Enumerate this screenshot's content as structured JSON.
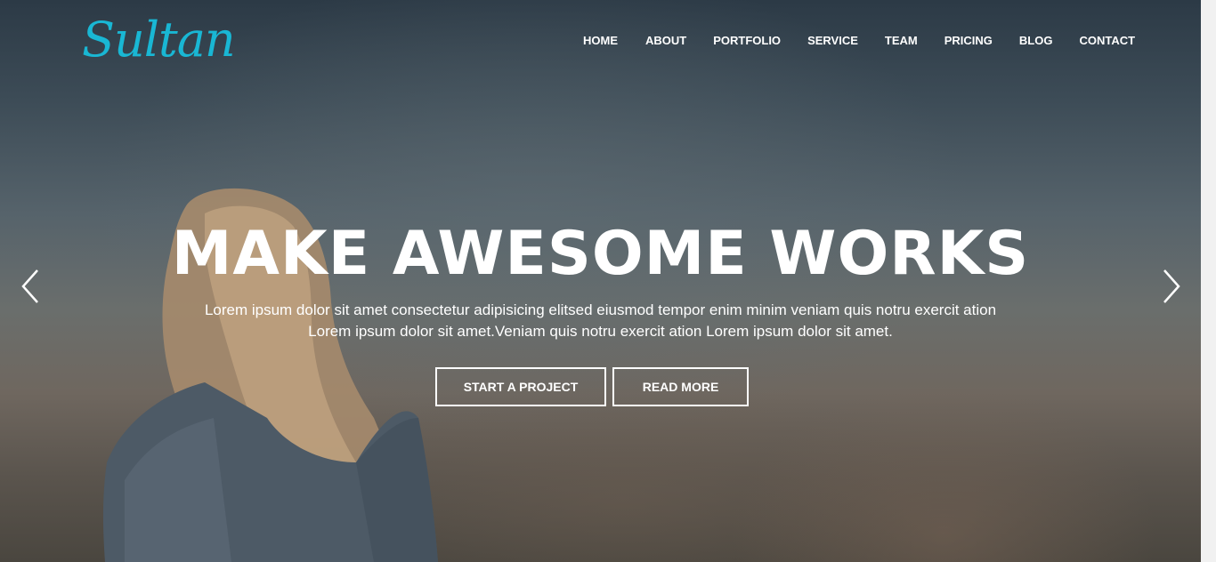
{
  "brand": {
    "logo_text": "Sultan",
    "accent_color": "#19b7d4"
  },
  "nav": {
    "items": [
      {
        "label": "HOME"
      },
      {
        "label": "ABOUT"
      },
      {
        "label": "PORTFOLIO"
      },
      {
        "label": "SERVICE"
      },
      {
        "label": "TEAM"
      },
      {
        "label": "PRICING"
      },
      {
        "label": "BLOG"
      },
      {
        "label": "CONTACT"
      }
    ]
  },
  "hero": {
    "headline": "MAKE AWESOME WORKS",
    "subtext_line1": "Lorem ipsum dolor sit amet consectetur adipisicing elitsed eiusmod tempor enim minim veniam quis notru exercit ation",
    "subtext_line2": "Lorem ipsum dolor sit amet.Veniam quis notru exercit ation Lorem ipsum dolor sit amet.",
    "primary_button": "START A PROJECT",
    "secondary_button": "READ MORE",
    "prev_icon": "chevron-left-icon",
    "next_icon": "chevron-right-icon"
  }
}
